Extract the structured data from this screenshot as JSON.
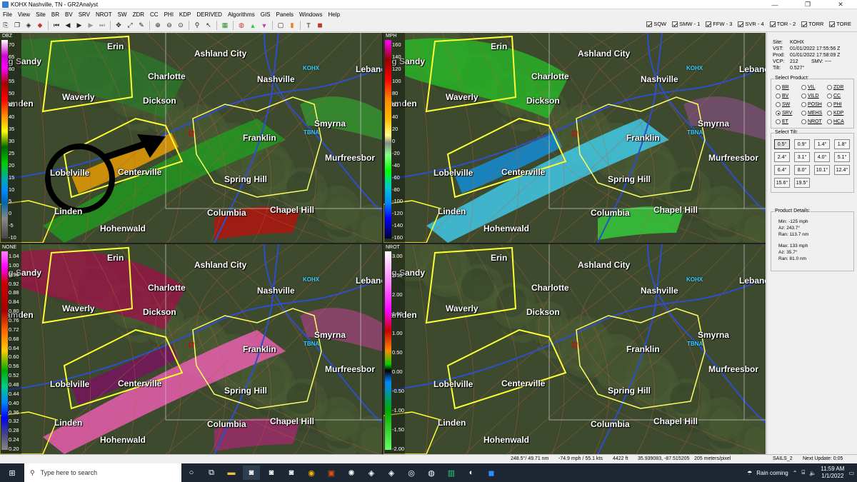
{
  "window": {
    "title": "KOHX Nashville, TN - GR2Analyst",
    "min": "—",
    "max": "❐",
    "close": "✕"
  },
  "menu": [
    "File",
    "View",
    "Site",
    "BR",
    "BV",
    "SRV",
    "NROT",
    "SW",
    "ZDR",
    "CC",
    "PHI",
    "KDP",
    "DERIVED",
    "Algorithms",
    "GIS",
    "Panels",
    "Windows",
    "Help"
  ],
  "warnings": [
    "SQW",
    "SMW - 1",
    "FFW - 3",
    "SVR - 4",
    "TOR - 2",
    "TORR",
    "TORE"
  ],
  "panels": [
    {
      "product": "DBZ",
      "ticks": [
        "70",
        "65",
        "60",
        "55",
        "50",
        "45",
        "40",
        "35",
        "30",
        "25",
        "20",
        "15",
        "10",
        "5",
        "0",
        "-5",
        "-10"
      ]
    },
    {
      "product": "MPH",
      "ticks": [
        "160",
        "140",
        "120",
        "100",
        "80",
        "60",
        "40",
        "20",
        "0",
        "-20",
        "-40",
        "-60",
        "-80",
        "-100",
        "-120",
        "-140",
        "-160"
      ]
    },
    {
      "product": "NONE",
      "ticks": [
        "1.04",
        "1.00",
        "0.96",
        "0.92",
        "0.88",
        "0.84",
        "0.80",
        "0.76",
        "0.72",
        "0.68",
        "0.64",
        "0.60",
        "0.56",
        "0.52",
        "0.48",
        "0.44",
        "0.40",
        "0.36",
        "0.32",
        "0.28",
        "0.24",
        "0.20"
      ]
    },
    {
      "product": "NROT",
      "ticks": [
        "3.00",
        "2.50",
        "2.00",
        "1.50",
        "1.00",
        "0.50",
        "0.00",
        "-0.50",
        "-1.00",
        "-1.50",
        "-2.00"
      ]
    }
  ],
  "cities": {
    "erin": "Erin",
    "big_sandy": "ig Sandy",
    "ashland_city": "Ashland City",
    "charlotte": "Charlotte",
    "nashville": "Nashville",
    "lebanon": "Lebano",
    "waverly": "Waverly",
    "camden": "amden",
    "dickson": "Dickson",
    "smyrna": "Smyrna",
    "franklin": "Franklin",
    "murfreesboro": "Murfreesbor",
    "lobelville": "Lobelville",
    "centerville": "Centerville",
    "spring_hill": "Spring Hill",
    "linden": "Linden",
    "columbia": "Columbia",
    "chapel_hill": "Chapel Hill",
    "hohenwald": "Hohenwald",
    "kohx": "KOHX",
    "tbna": "TBNA"
  },
  "site_info": {
    "site": "KOHX",
    "vst": "01/01/2022 17:55:56 Z",
    "prod": "01/01/2022 17:58:09 Z",
    "vcp": "212",
    "smv": "----",
    "tilt": "0.527°"
  },
  "labels": {
    "site": "Site:",
    "vst": "VST:",
    "prod": "Prod:",
    "vcp": "VCP:",
    "smv": "SMV:",
    "tilt": "Tilt:",
    "select_product": "Select Product:",
    "select_tilt": "Select Tilt:",
    "product_details": "Product Details:"
  },
  "products": [
    "BR",
    "VIL",
    "ZDR",
    "BV",
    "VILD",
    "CC",
    "SW",
    "POSH",
    "PHI",
    "SRV",
    "MEHS",
    "KDP",
    "ET",
    "NROT",
    "HCA"
  ],
  "selected_product": "SRV",
  "tilts": [
    "0.5°",
    "0.9°",
    "1.4°",
    "1.8°",
    "2.4°",
    "3.1°",
    "4.0°",
    "5.1°",
    "6.4°",
    "8.0°",
    "10.1°",
    "12.4°",
    "15.6°",
    "19.5°"
  ],
  "selected_tilt": "0.5°",
  "details": {
    "min": "Min: -125 mph",
    "min_az": "Az: 243.7°",
    "min_ran": "Ran: 113.7 nm",
    "max": "Max: 133 mph",
    "max_az": "Az: 35.7°",
    "max_ran": "Ran: 81.0 nm"
  },
  "status": {
    "azran": "248.5°/ 49.71 nm",
    "vel": "-74.9 mph / 55.1 kts",
    "height": "4422 ft",
    "latlon": "35.939083, -87.515205",
    "res": "205 meters/pixel",
    "sails": "SAILS_2",
    "next": "Next Update: 0:05"
  },
  "taskbar": {
    "search": "Type here to search",
    "weather": "Rain coming",
    "time": "11:59 AM",
    "date": "1/1/2022"
  },
  "colors": {
    "warning_yellow": "#ffff33",
    "taskbar": "#1c2733"
  }
}
